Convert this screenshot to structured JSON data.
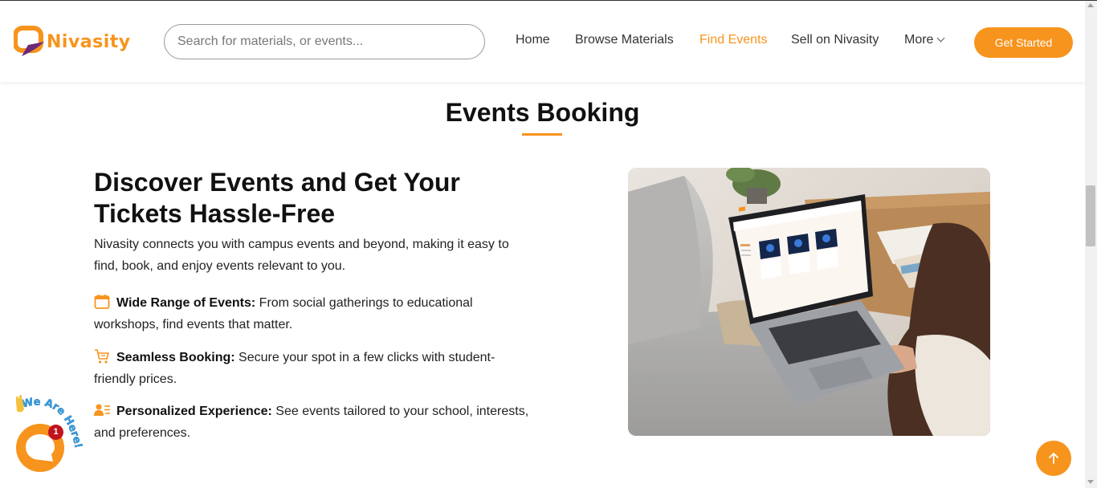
{
  "brand": {
    "name": "Nivasity",
    "accent": "#f7941d"
  },
  "search": {
    "placeholder": "Search for materials, or events..."
  },
  "nav": {
    "home": "Home",
    "browse": "Browse Materials",
    "find_events": "Find Events",
    "sell": "Sell on Nivasity",
    "more": "More",
    "cta": "Get Started"
  },
  "section": {
    "title": "Events Booking"
  },
  "content": {
    "heading": "Discover Events and Get Your Tickets Hassle-Free",
    "intro": "Nivasity connects you with campus events and beyond, making it easy to find, book, and enjoy events relevant to you.",
    "features": [
      {
        "icon": "calendar-icon",
        "title": "Wide Range of Events:",
        "text": " From social gatherings to educational workshops, find events that matter."
      },
      {
        "icon": "cart-icon",
        "title": "Seamless Booking:",
        "text": " Secure your spot in a few clicks with student-friendly prices."
      },
      {
        "icon": "user-list-icon",
        "title": "Personalized Experience:",
        "text": " See events tailored to your school, interests, and preferences."
      }
    ]
  },
  "chat": {
    "badge": "1",
    "tagline": "We Are Here!"
  },
  "icons": {
    "scroll_top": "arrow-up-icon",
    "chat": "chat-bubble-icon",
    "wave": "waving-hand-icon"
  }
}
